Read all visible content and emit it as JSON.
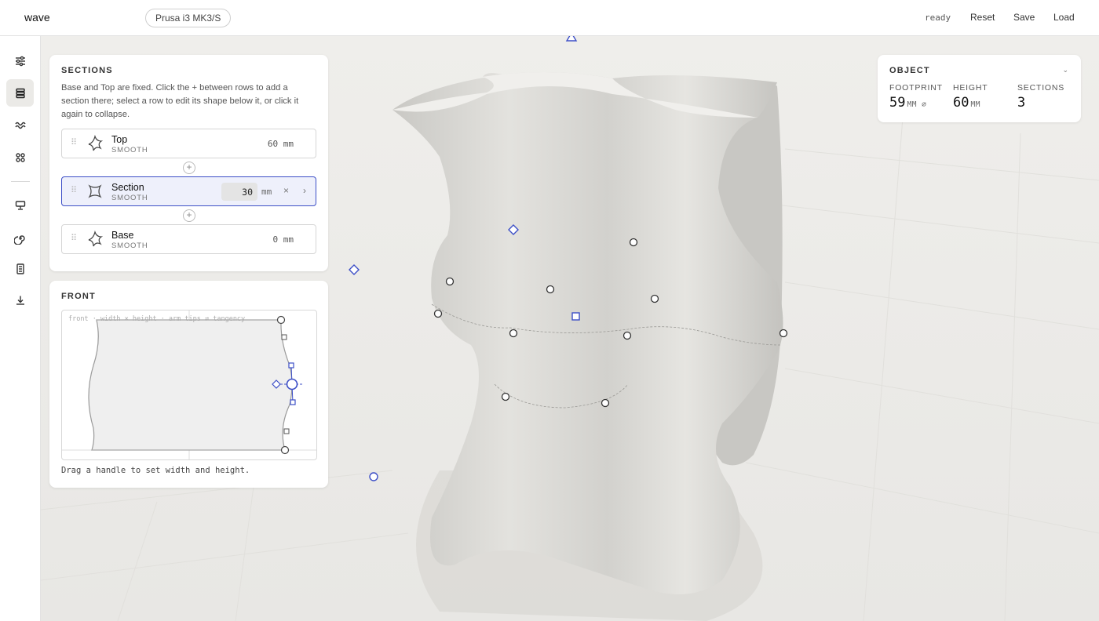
{
  "app": {
    "brand": "wave",
    "printer": "Prusa i3 MK3/S",
    "status": "ready"
  },
  "toolbar": {
    "reset": "Reset",
    "save": "Save",
    "load": "Load"
  },
  "rail": {
    "items": [
      {
        "icon": "sliders-icon",
        "active": false
      },
      {
        "icon": "layers-icon",
        "active": true
      },
      {
        "icon": "wave-icon",
        "active": false
      },
      {
        "icon": "grid-icon",
        "active": false
      },
      {
        "icon": "printer-icon",
        "active": false
      },
      {
        "icon": "spiral-icon",
        "active": false
      },
      {
        "icon": "document-icon",
        "active": false
      },
      {
        "icon": "download-icon",
        "active": false
      }
    ]
  },
  "sections": {
    "title": "SECTIONS",
    "description": "Base and Top are fixed. Click the + between rows to add a section there; select a row to edit its shape below it, or click it again to collapse.",
    "add_label": "+",
    "rows": [
      {
        "name": "Top",
        "sub": "SMOOTH",
        "value": "60 mm",
        "selected": false
      },
      {
        "name": "Section",
        "sub": "SMOOTH",
        "input": "30",
        "unit": "mm",
        "close": "×",
        "more": "›",
        "selected": true
      },
      {
        "name": "Base",
        "sub": "SMOOTH",
        "value": "0 mm",
        "selected": false
      }
    ]
  },
  "front": {
    "title": "FRONT",
    "caption": "front · width × height · arm tips ⇄ tangency",
    "hint": "Drag a handle to set width and height."
  },
  "object": {
    "title": "OBJECT",
    "collapse": "⌄",
    "stats": [
      {
        "label": "FOOTPRINT",
        "value": "59",
        "unit": "MM ⌀"
      },
      {
        "label": "HEIGHT",
        "value": "60",
        "unit": "MM"
      },
      {
        "label": "SECTIONS",
        "value": "3",
        "unit": ""
      }
    ]
  },
  "colors": {
    "accent": "#3d4fc7",
    "surface": "#ecebe8",
    "model": "#dcdbd7"
  }
}
